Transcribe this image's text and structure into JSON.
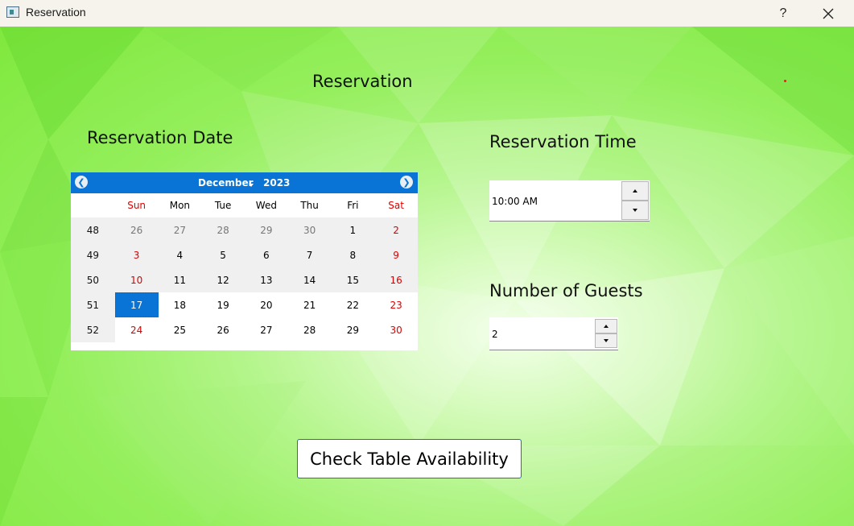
{
  "window": {
    "title": "Reservation",
    "help_label": "?"
  },
  "page": {
    "heading": "Reservation",
    "date_label": "Reservation Date",
    "time_label": "Reservation Time",
    "guests_label": "Number of Guests"
  },
  "calendar": {
    "month": "December",
    "year": "2023",
    "weekdays": [
      "Sun",
      "Mon",
      "Tue",
      "Wed",
      "Thu",
      "Fri",
      "Sat"
    ],
    "weeks": [
      {
        "number": "48",
        "days": [
          "26",
          "27",
          "28",
          "29",
          "30",
          "1",
          "2"
        ]
      },
      {
        "number": "49",
        "days": [
          "3",
          "4",
          "5",
          "6",
          "7",
          "8",
          "9"
        ]
      },
      {
        "number": "50",
        "days": [
          "10",
          "11",
          "12",
          "13",
          "14",
          "15",
          "16"
        ]
      },
      {
        "number": "51",
        "days": [
          "17",
          "18",
          "19",
          "20",
          "21",
          "22",
          "23"
        ]
      },
      {
        "number": "52",
        "days": [
          "24",
          "25",
          "26",
          "27",
          "28",
          "29",
          "30"
        ]
      }
    ],
    "selected_day": "17",
    "accent_color": "#0a73d6",
    "weekend_color": "#d00000"
  },
  "time": {
    "value": "10:00 AM"
  },
  "guests": {
    "value": "2"
  },
  "actions": {
    "check_label": "Check Table Availability"
  },
  "icons": {
    "prev": "arrow-left-icon",
    "next": "arrow-right-icon",
    "close": "close-icon",
    "up": "chevron-up-icon",
    "down": "chevron-down-icon"
  }
}
